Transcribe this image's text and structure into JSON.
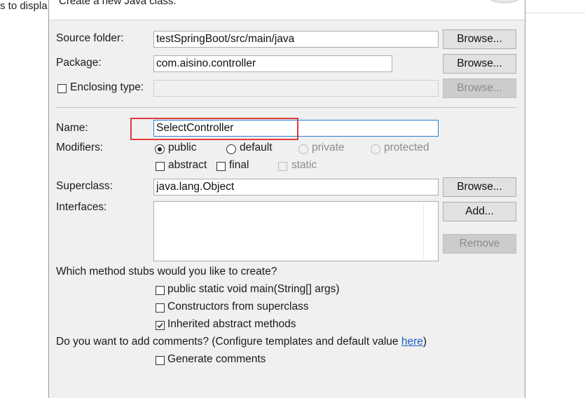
{
  "background": {
    "partial_text": "s to displa"
  },
  "dialog": {
    "header_text": "Create a new Java class.",
    "source_folder": {
      "label": "Source folder:",
      "value": "testSpringBoot/src/main/java",
      "button": "Browse..."
    },
    "package": {
      "label": "Package:",
      "value": "com.aisino.controller",
      "button": "Browse..."
    },
    "enclosing_type": {
      "label": "Enclosing type:",
      "value": "",
      "button": "Browse...",
      "checked": false
    },
    "name": {
      "label": "Name:",
      "value": "SelectController"
    },
    "modifiers": {
      "label": "Modifiers:",
      "access": [
        {
          "label": "public",
          "selected": true,
          "enabled": true
        },
        {
          "label": "default",
          "selected": false,
          "enabled": true
        },
        {
          "label": "private",
          "selected": false,
          "enabled": false
        },
        {
          "label": "protected",
          "selected": false,
          "enabled": false
        }
      ],
      "flags": [
        {
          "label": "abstract",
          "checked": false,
          "enabled": true
        },
        {
          "label": "final",
          "checked": false,
          "enabled": true
        },
        {
          "label": "static",
          "checked": false,
          "enabled": false
        }
      ]
    },
    "superclass": {
      "label": "Superclass:",
      "value": "java.lang.Object",
      "button": "Browse..."
    },
    "interfaces": {
      "label": "Interfaces:",
      "add_button": "Add...",
      "remove_button": "Remove",
      "items": []
    },
    "method_stubs": {
      "question": "Which method stubs would you like to create?",
      "options": [
        {
          "label": "public static void main(String[] args)",
          "checked": false
        },
        {
          "label": "Constructors from superclass",
          "checked": false
        },
        {
          "label": "Inherited abstract methods",
          "checked": true
        }
      ]
    },
    "comments": {
      "question_prefix": "Do you want to add comments? (Configure templates and default value ",
      "link": "here",
      "question_suffix": ")",
      "option": {
        "label": "Generate comments",
        "checked": false
      }
    }
  },
  "colors": {
    "dialog_bg": "#f0f0f0",
    "highlight": "#e03a3a",
    "focus_border": "#2e7fd3",
    "link": "#1a5fc2"
  }
}
